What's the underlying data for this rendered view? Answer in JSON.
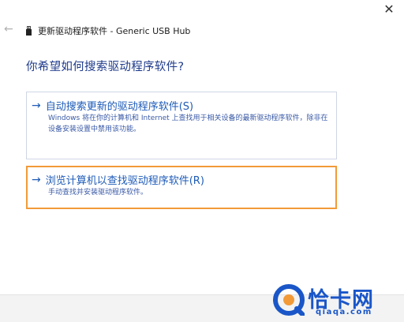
{
  "window": {
    "title": "更新驱动程序软件 - Generic USB Hub",
    "close_glyph": "✕",
    "back_glyph": "←"
  },
  "heading": "你希望如何搜索驱动程序软件?",
  "options": [
    {
      "arrow": "→",
      "title": "自动搜索更新的驱动程序软件(S)",
      "description": "Windows 将在你的计算机和 Internet 上查找用于相关设备的最新驱动程序软件，除非在设备安装设置中禁用该功能。"
    },
    {
      "arrow": "→",
      "title": "浏览计算机以查找驱动程序软件(R)",
      "description": "手动查找并安装驱动程序软件。"
    }
  ],
  "watermark": {
    "name": "恰卡网",
    "url": "qiaqa.com"
  },
  "colors": {
    "accent_blue": "#1e5bb8",
    "highlight_orange": "#f29a38",
    "watermark_blue": "#1a56c8"
  }
}
